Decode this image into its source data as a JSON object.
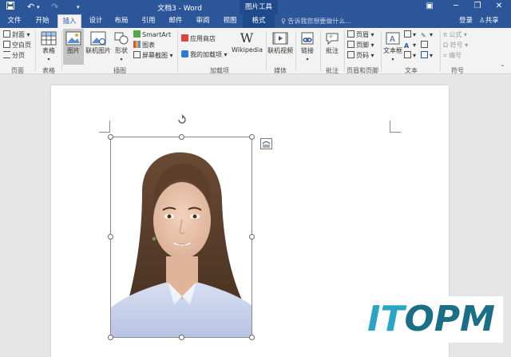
{
  "title_bar": {
    "doc_title": "文档3 - Word",
    "tools_label": "图片工具",
    "icons": [
      "save-icon",
      "undo-icon",
      "redo-icon",
      "customize-icon"
    ],
    "window": [
      "ribbon-options-icon",
      "minimize-icon",
      "restore-icon",
      "close-icon"
    ]
  },
  "tabs": {
    "file": "文件",
    "home": "开始",
    "insert": "插入",
    "design": "设计",
    "layout": "布局",
    "references": "引用",
    "mailings": "邮件",
    "review": "审阅",
    "view": "视图",
    "format": "格式",
    "tell_me": "告诉我您想要做什么...",
    "login": "登录",
    "share": "共享"
  },
  "ribbon": {
    "pages": {
      "cover": "封面",
      "blank": "空白页",
      "break": "分页",
      "label": "页面"
    },
    "tables": {
      "table": "表格",
      "label": "表格"
    },
    "illustrations": {
      "picture": "图片",
      "online_picture": "联机图片",
      "shapes": "形状",
      "smartart": "SmartArt",
      "chart": "图表",
      "screenshot": "屏幕截图",
      "label": "插图"
    },
    "addins": {
      "store": "应用商店",
      "my_addins": "我的加载项",
      "wikipedia": "Wikipedia",
      "label": "加载项"
    },
    "media": {
      "online_video": "联机视频",
      "label": "媒体"
    },
    "links": {
      "link": "链接",
      "label": ""
    },
    "comments": {
      "comment": "批注",
      "label": "批注"
    },
    "header_footer": {
      "header": "页眉",
      "footer": "页脚",
      "page_number": "页码",
      "label": "页眉和页脚"
    },
    "text": {
      "textbox": "文本框",
      "label": "文本"
    },
    "symbols": {
      "equation": "公式",
      "symbol": "符号",
      "number": "编号",
      "label": "符号"
    }
  },
  "watermark": {
    "text_a": "IT",
    "text_b": "OPM"
  },
  "colors": {
    "accent": "#2b579a",
    "watermark": "#1a6f86"
  }
}
